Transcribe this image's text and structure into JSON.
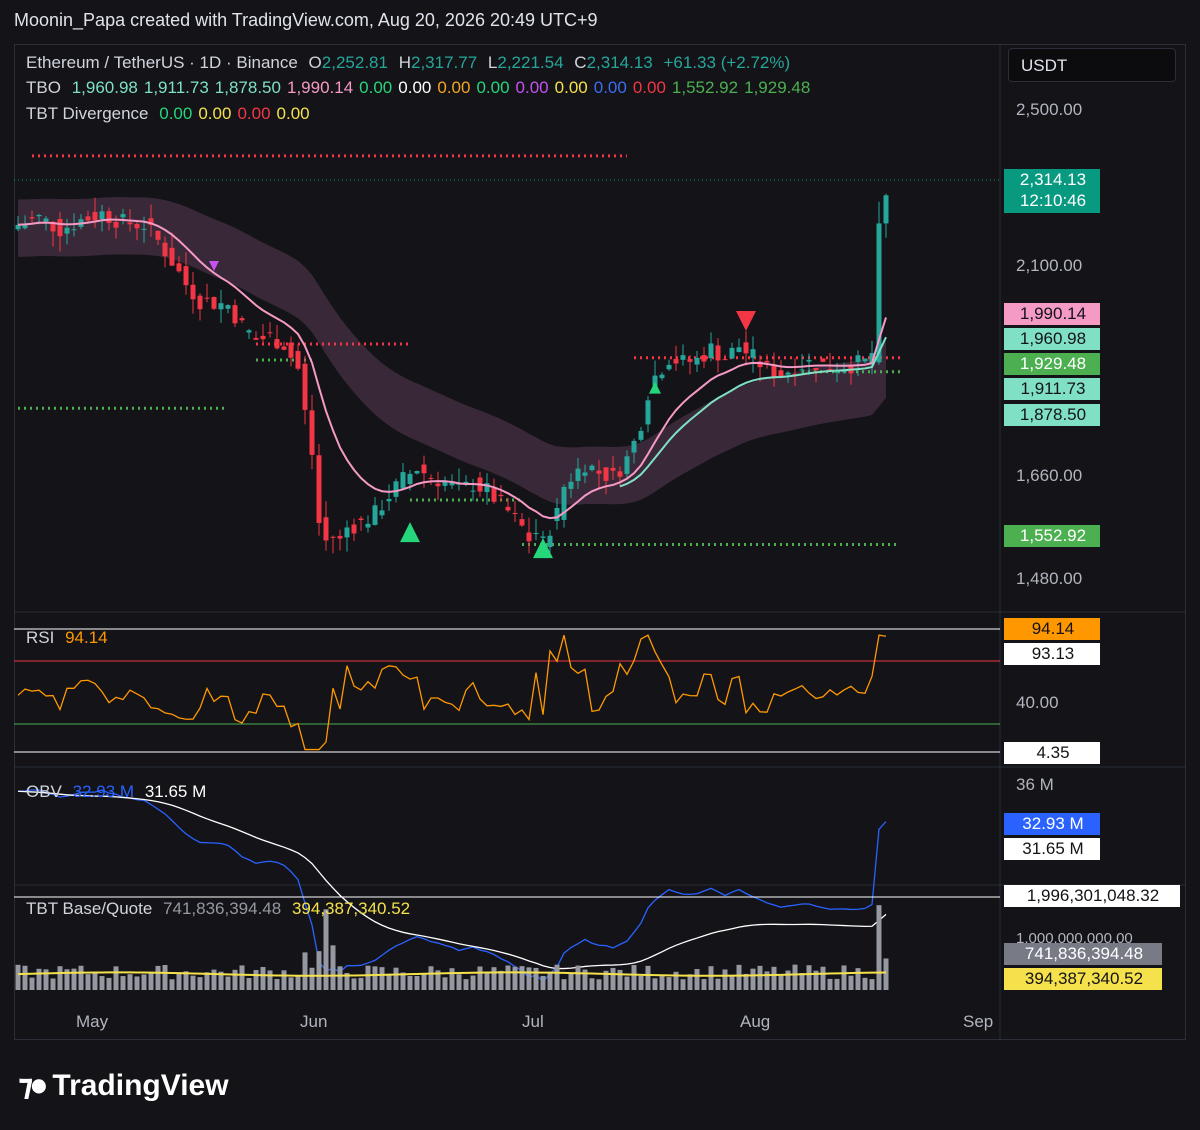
{
  "header": {
    "text": "Moonin_Papa created with TradingView.com, Aug 20, 2026 20:49 UTC+9"
  },
  "currency_button": "USDT",
  "legend": {
    "symbol": "Ethereum / TetherUS · 1D · Binance",
    "o_label": "O",
    "o": "2,252.81",
    "h_label": "H",
    "h": "2,317.77",
    "l_label": "L",
    "l": "2,221.54",
    "c_label": "C",
    "c": "2,314.13",
    "change": "+61.33 (+2.72%)",
    "tbo_label": "TBO",
    "tbo_values": [
      {
        "v": "1,960.98",
        "color": "#7fe0c6"
      },
      {
        "v": "1,911.73",
        "color": "#7fe0c6"
      },
      {
        "v": "1,878.50",
        "color": "#7fe0c6"
      },
      {
        "v": "1,990.14",
        "color": "#f59ac4"
      },
      {
        "v": "0.00",
        "color": "#26d67a"
      },
      {
        "v": "0.00",
        "color": "#ffffff"
      },
      {
        "v": "0.00",
        "color": "#f5a623"
      },
      {
        "v": "0.00",
        "color": "#26d67a"
      },
      {
        "v": "0.00",
        "color": "#c652f0"
      },
      {
        "v": "0.00",
        "color": "#f5e14b"
      },
      {
        "v": "0.00",
        "color": "#3d6cf0"
      },
      {
        "v": "0.00",
        "color": "#f23645"
      },
      {
        "v": "1,552.92",
        "color": "#4caf50"
      },
      {
        "v": "1,929.48",
        "color": "#4caf50"
      }
    ],
    "div_label": "TBT Divergence",
    "div_values": [
      {
        "v": "0.00",
        "color": "#26d67a"
      },
      {
        "v": "0.00",
        "color": "#f5e14b"
      },
      {
        "v": "0.00",
        "color": "#f23645"
      },
      {
        "v": "0.00",
        "color": "#f5e14b"
      }
    ]
  },
  "price_axis": {
    "labels": [
      "2,500.00",
      "2,100.00",
      "1,660.00",
      "1,480.00"
    ],
    "tags": [
      {
        "v": "2,314.13",
        "sub": "12:10:46",
        "bg": "#089981",
        "fg": "#ffffff"
      },
      {
        "v": "1,990.14",
        "bg": "#f59ac4",
        "fg": "#131318"
      },
      {
        "v": "1,960.98",
        "bg": "#7fe0c6",
        "fg": "#131318"
      },
      {
        "v": "1,929.48",
        "bg": "#4caf50",
        "fg": "#ffffff"
      },
      {
        "v": "1,911.73",
        "bg": "#7fe0c6",
        "fg": "#131318"
      },
      {
        "v": "1,878.50",
        "bg": "#7fe0c6",
        "fg": "#131318"
      },
      {
        "v": "1,552.92",
        "bg": "#4caf50",
        "fg": "#ffffff"
      }
    ]
  },
  "rsi": {
    "label": "RSI",
    "value": "94.14",
    "axis_label": "40.00",
    "tags": [
      {
        "v": "94.14",
        "bg": "#ff9800",
        "fg": "#131318"
      },
      {
        "v": "93.13",
        "bg": "#ffffff",
        "fg": "#131318"
      },
      {
        "v": "4.35",
        "bg": "#ffffff",
        "fg": "#131318"
      }
    ]
  },
  "obv": {
    "label": "OBV",
    "value1": "32.93 M",
    "value2": "31.65 M",
    "axis_label": "36 M",
    "tags": [
      {
        "v": "32.93 M",
        "bg": "#2962ff",
        "fg": "#ffffff"
      },
      {
        "v": "31.65 M",
        "bg": "#ffffff",
        "fg": "#131318"
      }
    ]
  },
  "volume": {
    "label": "TBT Base/Quote",
    "value1": "741,836,394.48",
    "value2": "394,387,340.52",
    "axis_label": "1,000,000,000.00",
    "tags": [
      {
        "v": "1,996,301,048.32",
        "bg": "#ffffff",
        "fg": "#131318"
      },
      {
        "v": "741,836,394.48",
        "bg": "#787b86",
        "fg": "#ffffff"
      },
      {
        "v": "394,387,340.52",
        "bg": "#f5e14b",
        "fg": "#131318"
      }
    ]
  },
  "time_axis": [
    "May",
    "Jun",
    "Jul",
    "Aug",
    "Sep"
  ],
  "footer": {
    "brand": "TradingView"
  },
  "chart_data": {
    "type": "candlestick",
    "symbol": "Ethereum / TetherUS · 1D · Binance",
    "x_range": [
      "May",
      "Sep"
    ],
    "ylim": [
      1480,
      2500
    ],
    "close_path": [
      [
        0,
        2250
      ],
      [
        3,
        2265
      ],
      [
        6,
        2240
      ],
      [
        9,
        2260
      ],
      [
        12,
        2275
      ],
      [
        15,
        2255
      ],
      [
        18,
        2250
      ],
      [
        20,
        2215
      ],
      [
        22,
        2170
      ],
      [
        24,
        2120
      ],
      [
        26,
        2085
      ],
      [
        28,
        2080
      ],
      [
        30,
        2075
      ],
      [
        32,
        2030
      ],
      [
        34,
        2000
      ],
      [
        36,
        2005
      ],
      [
        38,
        1990
      ],
      [
        40,
        1935
      ],
      [
        41,
        1840
      ],
      [
        42,
        1750
      ],
      [
        43,
        1600
      ],
      [
        44,
        1560
      ],
      [
        45,
        1570
      ],
      [
        46,
        1560
      ],
      [
        47,
        1590
      ],
      [
        49,
        1600
      ],
      [
        51,
        1620
      ],
      [
        53,
        1660
      ],
      [
        55,
        1695
      ],
      [
        57,
        1720
      ],
      [
        59,
        1700
      ],
      [
        61,
        1690
      ],
      [
        63,
        1670
      ],
      [
        65,
        1685
      ],
      [
        67,
        1670
      ],
      [
        69,
        1640
      ],
      [
        70,
        1625
      ],
      [
        72,
        1590
      ],
      [
        73,
        1565
      ],
      [
        74,
        1580
      ],
      [
        75,
        1555
      ],
      [
        76,
        1590
      ],
      [
        77,
        1620
      ],
      [
        78,
        1680
      ],
      [
        79,
        1700
      ],
      [
        81,
        1730
      ],
      [
        83,
        1710
      ],
      [
        85,
        1700
      ],
      [
        87,
        1740
      ],
      [
        88,
        1775
      ],
      [
        89,
        1820
      ],
      [
        90,
        1885
      ],
      [
        91,
        1920
      ],
      [
        93,
        1960
      ],
      [
        95,
        1950
      ],
      [
        97,
        1955
      ],
      [
        99,
        1980
      ],
      [
        101,
        1960
      ],
      [
        103,
        1985
      ],
      [
        105,
        1960
      ],
      [
        107,
        1935
      ],
      [
        109,
        1925
      ],
      [
        111,
        1940
      ],
      [
        113,
        1950
      ],
      [
        115,
        1945
      ],
      [
        117,
        1940
      ],
      [
        119,
        1945
      ],
      [
        121,
        1950
      ],
      [
        122,
        1970
      ],
      [
        123,
        2280
      ],
      [
        124,
        2314
      ]
    ],
    "tbo_levels": [
      1990.14,
      1960.98,
      1929.48,
      1911.73,
      1878.5,
      1552.92
    ],
    "rsi_last": 94.14,
    "obv_last": [
      32.93,
      31.65
    ],
    "volume_last": [
      741836394.48,
      394387340.52
    ]
  }
}
